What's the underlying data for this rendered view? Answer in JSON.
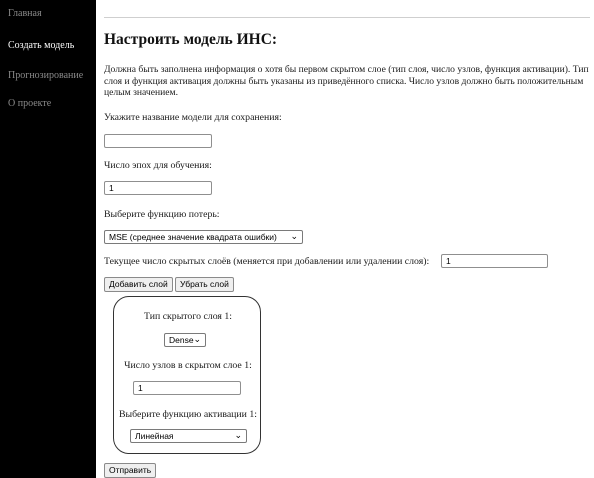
{
  "sidebar": {
    "items": [
      {
        "label": "Главная",
        "active": false
      },
      {
        "label": "Создать модель",
        "active": true
      },
      {
        "label": "Прогнозирование",
        "active": false
      },
      {
        "label": "О проекте",
        "active": false
      }
    ]
  },
  "main": {
    "title": "Настроить модель ИНС:",
    "description": "Должна быть заполнена информация о хотя бы первом скрытом слое (тип слоя, число узлов, функция активации). Тип слоя и функция активация должны быть указаны из приведённого списка. Число узлов должно быть положительным целым значением.",
    "model_name": {
      "label": "Укажите название модели для сохранения:",
      "value": ""
    },
    "epochs": {
      "label": "Число эпох для обучения:",
      "value": "1"
    },
    "loss": {
      "label": "Выберите функцию потерь:",
      "selected": "MSE (среднее значение квадрата ошибки)"
    },
    "layers_count": {
      "label": "Текущее число скрытых слоёв (меняется при добавлении или удалении слоя):",
      "value": "1"
    },
    "add_layer_label": "Добавить слой",
    "remove_layer_label": "Убрать слой",
    "layer": {
      "type_label": "Тип скрытого слоя 1:",
      "type_selected": "Dense",
      "nodes_label": "Число узлов в скрытом слое 1:",
      "nodes_value": "1",
      "activation_label": "Выберите функцию активации 1:",
      "activation_selected": "Линейная"
    },
    "submit_label": "Отправить"
  }
}
